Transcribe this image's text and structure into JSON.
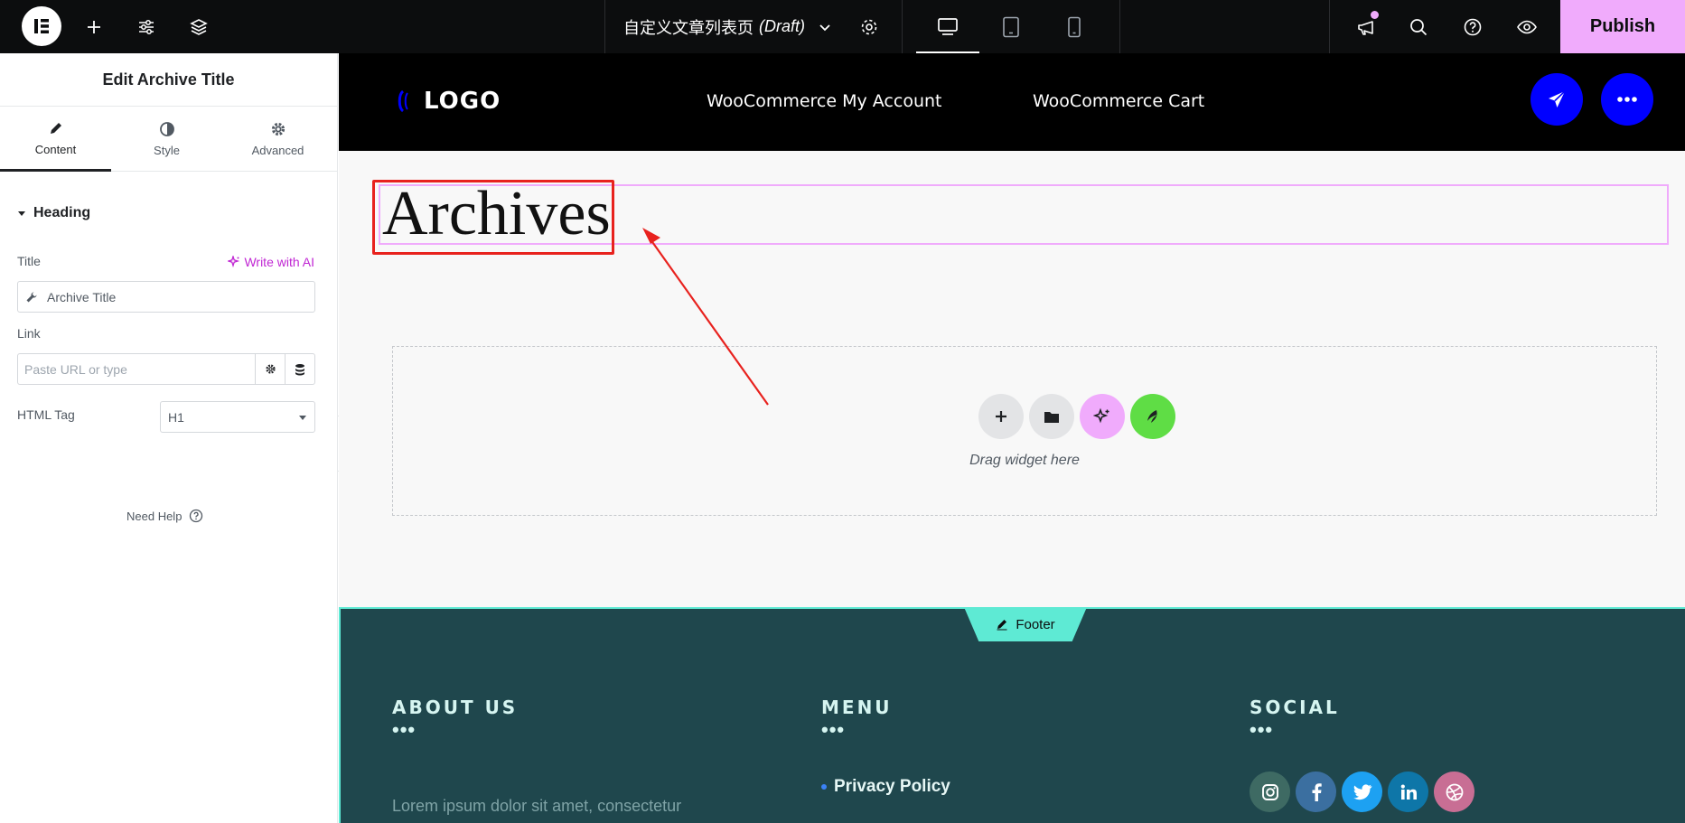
{
  "topbar": {
    "doc_title": "自定义文章列表页",
    "doc_status": "(Draft)",
    "publish_label": "Publish"
  },
  "panel": {
    "title": "Edit Archive Title",
    "tabs": [
      {
        "label": "Content",
        "icon": "pencil-icon"
      },
      {
        "label": "Style",
        "icon": "half-circle-icon"
      },
      {
        "label": "Advanced",
        "icon": "gear-icon"
      }
    ],
    "section": "Heading",
    "title_label": "Title",
    "ai_label": "Write with AI",
    "title_value": "Archive Title",
    "link_label": "Link",
    "link_placeholder": "Paste URL or type",
    "html_tag_label": "HTML Tag",
    "html_tag_value": "H1",
    "need_help": "Need Help"
  },
  "site": {
    "logo_text": "LOGO",
    "nav": [
      "WooCommerce My Account",
      "WooCommerce Cart"
    ],
    "archive_title": "Archives",
    "drag_text": "Drag widget here"
  },
  "footer": {
    "tag": "Footer",
    "about_title": "ABOUT US",
    "menu_title": "MENU",
    "social_title": "SOCIAL",
    "dots": "•••",
    "lorem": "Lorem ipsum dolor sit amet, consectetur",
    "menu_items": [
      "Privacy Policy"
    ],
    "social": [
      {
        "name": "instagram-icon",
        "color": "#3e6a63"
      },
      {
        "name": "facebook-icon",
        "color": "#3b6fa0"
      },
      {
        "name": "twitter-icon",
        "color": "#1da1f2"
      },
      {
        "name": "linkedin-icon",
        "color": "#0e76a8"
      },
      {
        "name": "dribbble-icon",
        "color": "#c86e94"
      }
    ]
  },
  "colors": {
    "accent": "#f0abfc",
    "brand_blue": "#0000ff",
    "footer_bg": "#1f474d",
    "footer_border": "#5eead4",
    "highlight": "#e8221e"
  }
}
